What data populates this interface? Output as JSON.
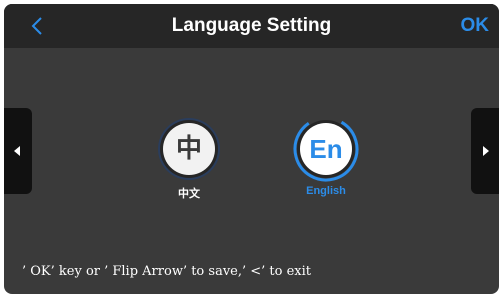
{
  "header": {
    "back_label": "<",
    "title": "Language Setting",
    "ok_label": "OK"
  },
  "languages": [
    {
      "glyph": "中",
      "label": "中文",
      "selected": false
    },
    {
      "glyph": "En",
      "label": "English",
      "selected": true
    }
  ],
  "hint": "’ OK’ key or ’ Flip Arrow’ to save,’ <’ to exit",
  "icons": {
    "back": "chevron-left-icon",
    "prev": "triangle-left-icon",
    "next": "triangle-right-icon"
  },
  "colors": {
    "accent": "#2b8ce8",
    "header_bg": "#262626",
    "body_bg": "#3a3a3a"
  }
}
